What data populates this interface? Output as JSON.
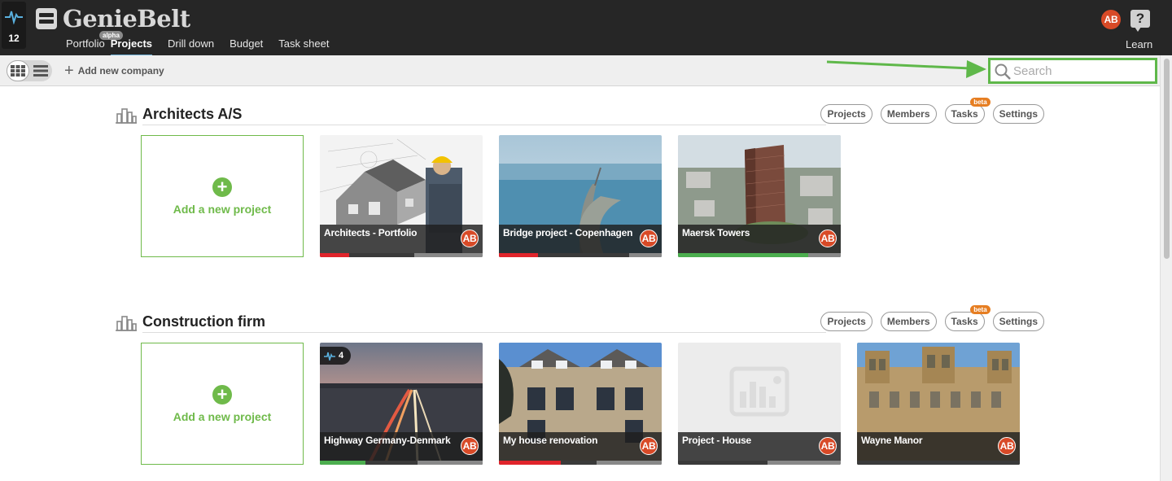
{
  "header": {
    "pulse_count": "12",
    "logo_text": "GenieBelt",
    "nav": [
      {
        "label": "Portfolio",
        "badge": "alpha"
      },
      {
        "label": "Projects"
      },
      {
        "label": "Drill down"
      },
      {
        "label": "Budget"
      },
      {
        "label": "Task sheet"
      }
    ],
    "user_initials": "AB",
    "help_label": "?",
    "learn_label": "Learn"
  },
  "toolbar": {
    "add_company_label": "Add new company",
    "search_placeholder": "Search",
    "search_value": ""
  },
  "colors": {
    "accent_green": "#6fba4a",
    "avatar": "#d84a27",
    "highlight": "#5fb84a",
    "beta_badge": "#e67e22",
    "progress_red": "#e0242b",
    "progress_green": "#4cae4f"
  },
  "companies": [
    {
      "name": "Architects A/S",
      "pills": [
        "Projects",
        "Members",
        "Tasks",
        "Settings"
      ],
      "beta_label": "beta",
      "add_project_label": "Add a new project",
      "projects": [
        {
          "name": "Architects - Portfolio",
          "initials": "AB",
          "progress": 0.58,
          "status": "red",
          "status_fraction": 0.18
        },
        {
          "name": "Bridge project - Copenhagen",
          "initials": "AB",
          "progress": 0.8,
          "status": "red",
          "status_fraction": 0.24
        },
        {
          "name": "Maersk Towers",
          "initials": "AB",
          "progress": 0.8,
          "status": "green",
          "status_fraction": 0.8
        }
      ]
    },
    {
      "name": "Construction firm",
      "pills": [
        "Projects",
        "Members",
        "Tasks",
        "Settings"
      ],
      "beta_label": "beta",
      "add_project_label": "Add a new project",
      "projects": [
        {
          "name": "Highway Germany-Denmark",
          "initials": "AB",
          "pulse": "4",
          "progress": 0.6,
          "status": "green",
          "status_fraction": 0.28
        },
        {
          "name": "My house renovation",
          "initials": "AB",
          "progress": 0.6,
          "status": "red",
          "status_fraction": 0.38
        },
        {
          "name": "Project - House",
          "initials": "AB",
          "progress": 0.55,
          "status": "none",
          "status_fraction": 0
        },
        {
          "name": "Wayne Manor",
          "initials": "AB",
          "progress": 1.0,
          "status": "none",
          "status_fraction": 0
        }
      ]
    }
  ]
}
